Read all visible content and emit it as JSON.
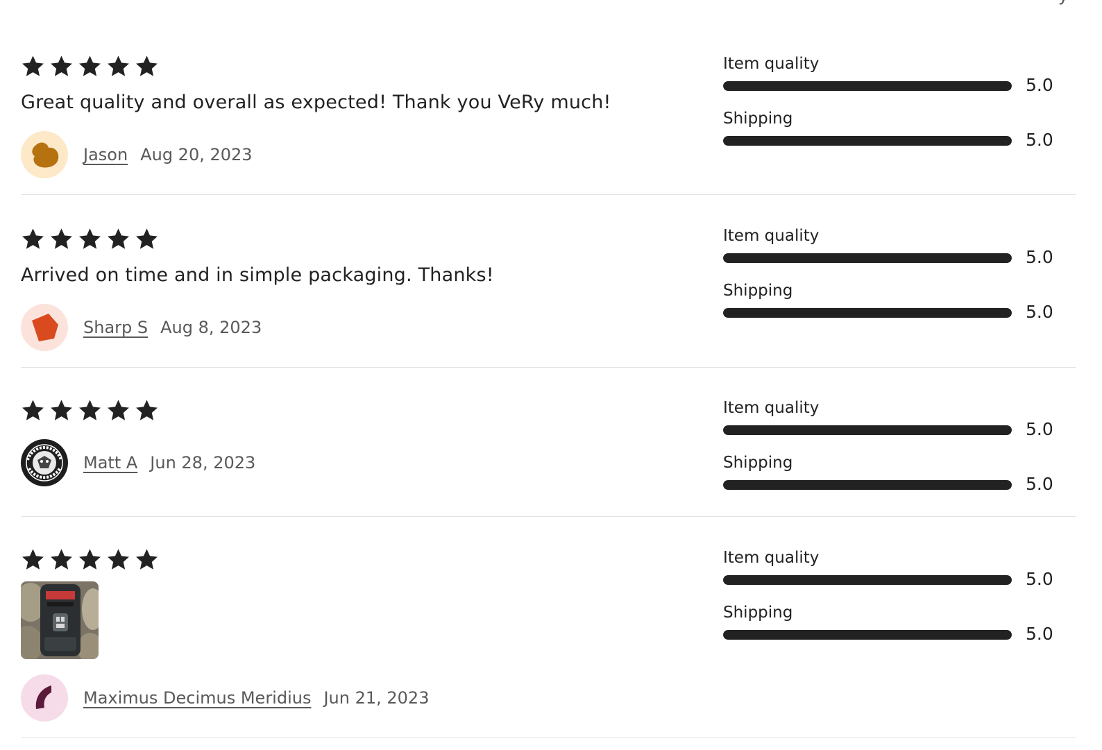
{
  "page": {
    "top_fragment_text": "y",
    "divider_color": "#e1e3df"
  },
  "reviews": [
    {
      "rating": 5,
      "text": "Great quality and overall as expected! Thank you VeRy much!",
      "reviewer": "Jason",
      "date": "Aug 20, 2023",
      "avatar": {
        "icon": "blob-avatar-icon",
        "bg": "#fde8c8",
        "color": "#b5720f"
      },
      "has_photo": false,
      "metrics": [
        {
          "label": "Item quality",
          "value": "5.0",
          "fraction": 1.0
        },
        {
          "label": "Shipping",
          "value": "5.0",
          "fraction": 1.0
        }
      ]
    },
    {
      "rating": 5,
      "text": "Arrived on time and in simple packaging. Thanks!",
      "reviewer": "Sharp S",
      "date": "Aug 8, 2023",
      "avatar": {
        "icon": "pentagon-avatar-icon",
        "bg": "#fbe3dc",
        "color": "#d94a1f"
      },
      "has_photo": false,
      "metrics": [
        {
          "label": "Item quality",
          "value": "5.0",
          "fraction": 1.0
        },
        {
          "label": "Shipping",
          "value": "5.0",
          "fraction": 1.0
        }
      ]
    },
    {
      "rating": 5,
      "text": "",
      "reviewer": "Matt A",
      "date": "Jun 28, 2023",
      "avatar": {
        "icon": "badge-logo-avatar-icon",
        "bg": "#1e1e1e",
        "color": "#ffffff"
      },
      "has_photo": false,
      "metrics": [
        {
          "label": "Item quality",
          "value": "5.0",
          "fraction": 1.0
        },
        {
          "label": "Shipping",
          "value": "5.0",
          "fraction": 1.0
        }
      ]
    },
    {
      "rating": 5,
      "text": "",
      "reviewer": "Maximus Decimus Meridius",
      "date": "Jun 21, 2023",
      "avatar": {
        "icon": "crescent-avatar-icon",
        "bg": "#f6dbe8",
        "color": "#5b1a3a"
      },
      "has_photo": true,
      "metrics": [
        {
          "label": "Item quality",
          "value": "5.0",
          "fraction": 1.0
        },
        {
          "label": "Shipping",
          "value": "5.0",
          "fraction": 1.0
        }
      ]
    }
  ]
}
